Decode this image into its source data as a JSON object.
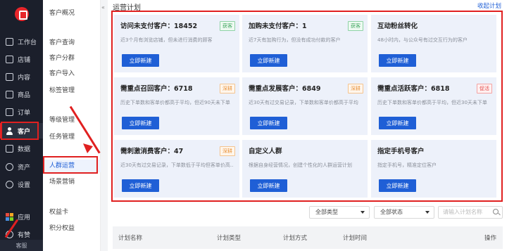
{
  "nav": {
    "items": [
      {
        "label": "工作台",
        "icon": "monitor-icon"
      },
      {
        "label": "店铺",
        "icon": "store-icon"
      },
      {
        "label": "内容",
        "icon": "content-icon"
      },
      {
        "label": "商品",
        "icon": "goods-icon"
      },
      {
        "label": "订单",
        "icon": "order-icon"
      },
      {
        "label": "客户",
        "icon": "user-icon"
      },
      {
        "label": "数据",
        "icon": "data-icon"
      },
      {
        "label": "资产",
        "icon": "asset-icon"
      },
      {
        "label": "设置",
        "icon": "gear-icon"
      },
      {
        "label": "应用",
        "icon": "apps-icon"
      },
      {
        "label": "有赞",
        "icon": "brand-icon"
      }
    ],
    "bottom": "客服"
  },
  "submenu": {
    "items": [
      "客户概况",
      "客户查询",
      "客户分群",
      "客户导入",
      "标签管理",
      "等级管理",
      "任务管理",
      "人群运营",
      "场景营销",
      "权益卡",
      "积分权益"
    ]
  },
  "page": {
    "title": "运营计划",
    "collapse": "收起计划"
  },
  "cards": [
    {
      "title": "访问未支付客户：18452",
      "desc": "近3个月有浏览店铺，但未进行消费的顾客",
      "tag": "获客",
      "tag_color": "green",
      "button": "立即新建"
    },
    {
      "title": "加购未支付客户：1",
      "desc": "近7天有加购行为，但没有成功付款的客户",
      "tag": "获客",
      "tag_color": "green",
      "button": "立即新建"
    },
    {
      "title": "互动粉丝转化",
      "desc": "48小时内，与公众号有过交互行为的客户",
      "tag": "",
      "tag_color": "",
      "button": "立即新建"
    },
    {
      "title": "需重点召回客户：6718",
      "desc": "历史下单数和客单价都高于平均，但近90天未下单",
      "tag": "深耕",
      "tag_color": "orange",
      "button": "立即新建"
    },
    {
      "title": "需重点发展客户：6849",
      "desc": "近30天有过交易记录，下单数和客单价都高于平均",
      "tag": "深耕",
      "tag_color": "orange",
      "button": "立即新建"
    },
    {
      "title": "需重点活跃客户：6818",
      "desc": "历史下单数和客单价都高于平均，但近30天未下单",
      "tag": "促活",
      "tag_color": "red",
      "button": "立即新建"
    },
    {
      "title": "需刺激消费客户：47",
      "desc": "近30天有过交易记录，下单数低于平均但客单价高...",
      "tag": "深耕",
      "tag_color": "orange",
      "button": "立即新建"
    },
    {
      "title": "自定义人群",
      "desc": "根据自身经营情况，创建个性化的人群运营计划",
      "tag": "",
      "tag_color": "",
      "button": "立即新建"
    },
    {
      "title": "指定手机号客户",
      "desc": "指定手机号，精准定位客户",
      "tag": "",
      "tag_color": "",
      "button": "立即新建"
    }
  ],
  "filters": {
    "type": "全部类型",
    "status": "全部状态",
    "search_placeholder": "请输入计划名称"
  },
  "table": {
    "headers": [
      "计划名称",
      "计划类型",
      "计划方式",
      "计划时间",
      "操作"
    ]
  },
  "colors": {
    "primary": "#1f5fd6",
    "highlight": "#e02020",
    "nav_bg": "#1b1f2b"
  }
}
